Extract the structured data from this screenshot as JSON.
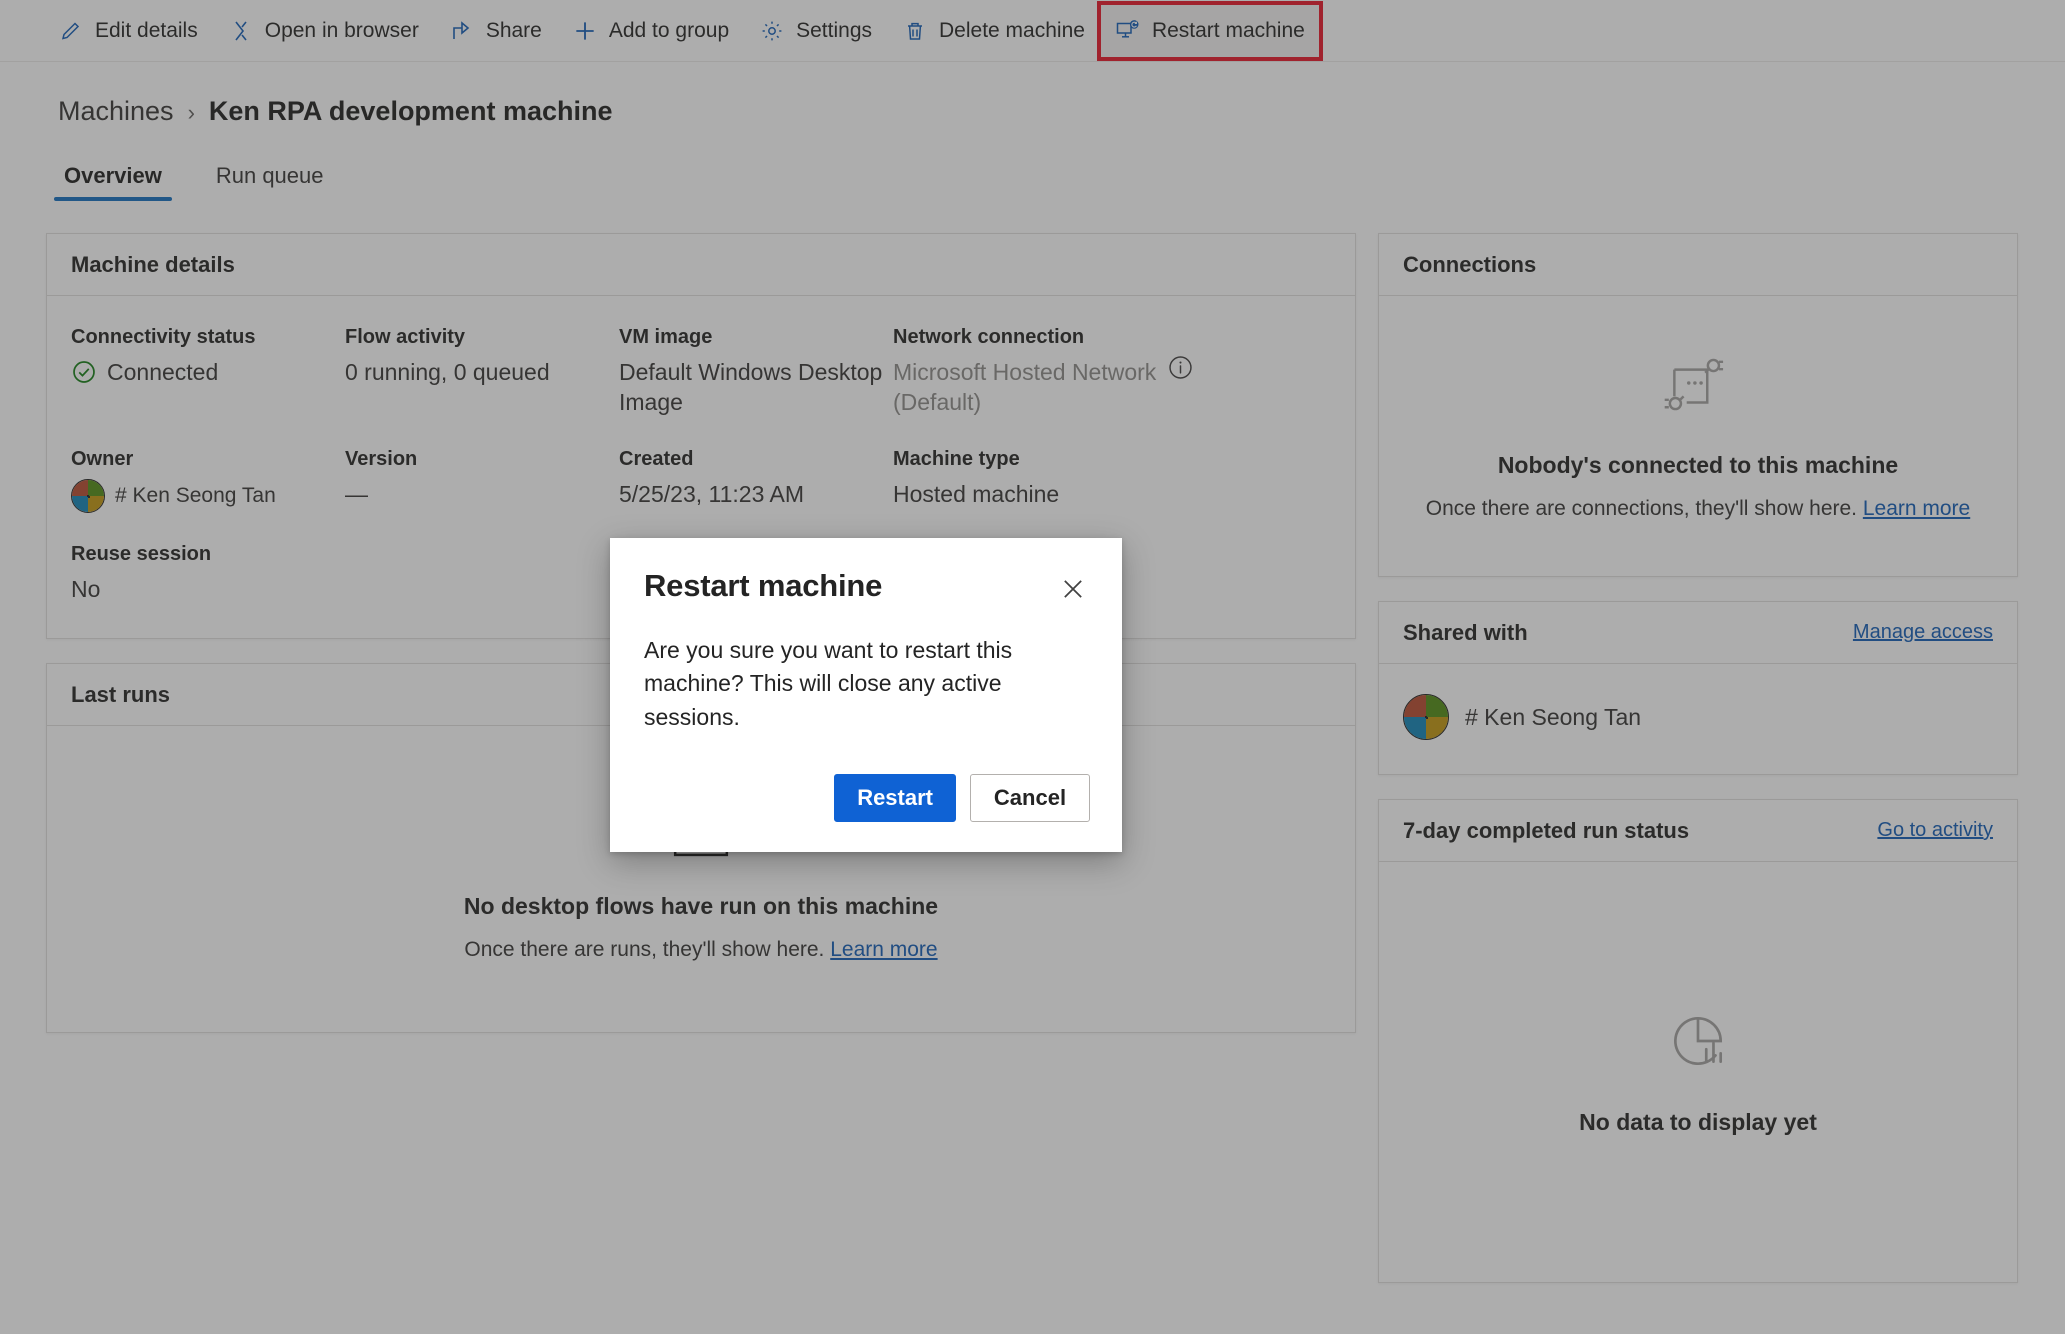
{
  "toolbar": {
    "items": [
      {
        "label": "Edit details",
        "icon": "pencil-icon"
      },
      {
        "label": "Open in browser",
        "icon": "open-in-browser-icon"
      },
      {
        "label": "Share",
        "icon": "share-icon"
      },
      {
        "label": "Add to group",
        "icon": "plus-icon"
      },
      {
        "label": "Settings",
        "icon": "gear-icon"
      },
      {
        "label": "Delete machine",
        "icon": "trash-icon"
      },
      {
        "label": "Restart machine",
        "icon": "restart-machine-icon"
      }
    ],
    "highlight_color": "#e81123",
    "icon_color": "#0f5bb5"
  },
  "breadcrumb": {
    "root": "Machines",
    "separator": "›",
    "current": "Ken RPA development machine"
  },
  "tabs": [
    {
      "label": "Overview",
      "active": true
    },
    {
      "label": "Run queue",
      "active": false
    }
  ],
  "machine_details": {
    "title": "Machine details",
    "fields": {
      "connectivity_status_label": "Connectivity status",
      "connectivity_status_value": "Connected",
      "flow_activity_label": "Flow activity",
      "flow_activity_value": "0 running, 0 queued",
      "vm_image_label": "VM image",
      "vm_image_value": "Default Windows Desktop Image",
      "network_connection_label": "Network connection",
      "network_connection_value": "Microsoft Hosted Network (Default)",
      "network_connection_info_icon": "info-icon",
      "owner_label": "Owner",
      "owner_value": "# Ken Seong Tan",
      "version_label": "Version",
      "version_value": "—",
      "created_label": "Created",
      "created_value": "5/25/23, 11:23 AM",
      "machine_type_label": "Machine type",
      "machine_type_value": "Hosted machine",
      "reuse_session_label": "Reuse session",
      "reuse_session_value": "No"
    },
    "status_color": "#107c10"
  },
  "last_runs": {
    "title": "Last runs",
    "empty_icon": "history-icon",
    "empty_title": "No desktop flows have run on this machine",
    "empty_sub_prefix": "Once there are runs, they'll show here. ",
    "empty_sub_link": "Learn more"
  },
  "connections": {
    "title": "Connections",
    "empty_icon": "plug-connection-icon",
    "empty_title": "Nobody's connected to this machine",
    "empty_sub_prefix": "Once there are connections, they'll show here. ",
    "empty_sub_link": "Learn more"
  },
  "shared_with": {
    "title": "Shared with",
    "action_label": "Manage access",
    "people": [
      {
        "name": "# Ken Seong Tan",
        "avatar": "ms-logo-avatar"
      }
    ]
  },
  "run_status": {
    "title": "7-day completed run status",
    "action_label": "Go to activity",
    "empty_icon": "pie-chart-icon",
    "empty_title": "No data to display yet"
  },
  "dialog": {
    "title": "Restart machine",
    "close_icon": "close-icon",
    "message": "Are you sure you want to restart this machine? This will close any active sessions.",
    "primary_label": "Restart",
    "secondary_label": "Cancel",
    "primary_color": "#0f62d4"
  }
}
